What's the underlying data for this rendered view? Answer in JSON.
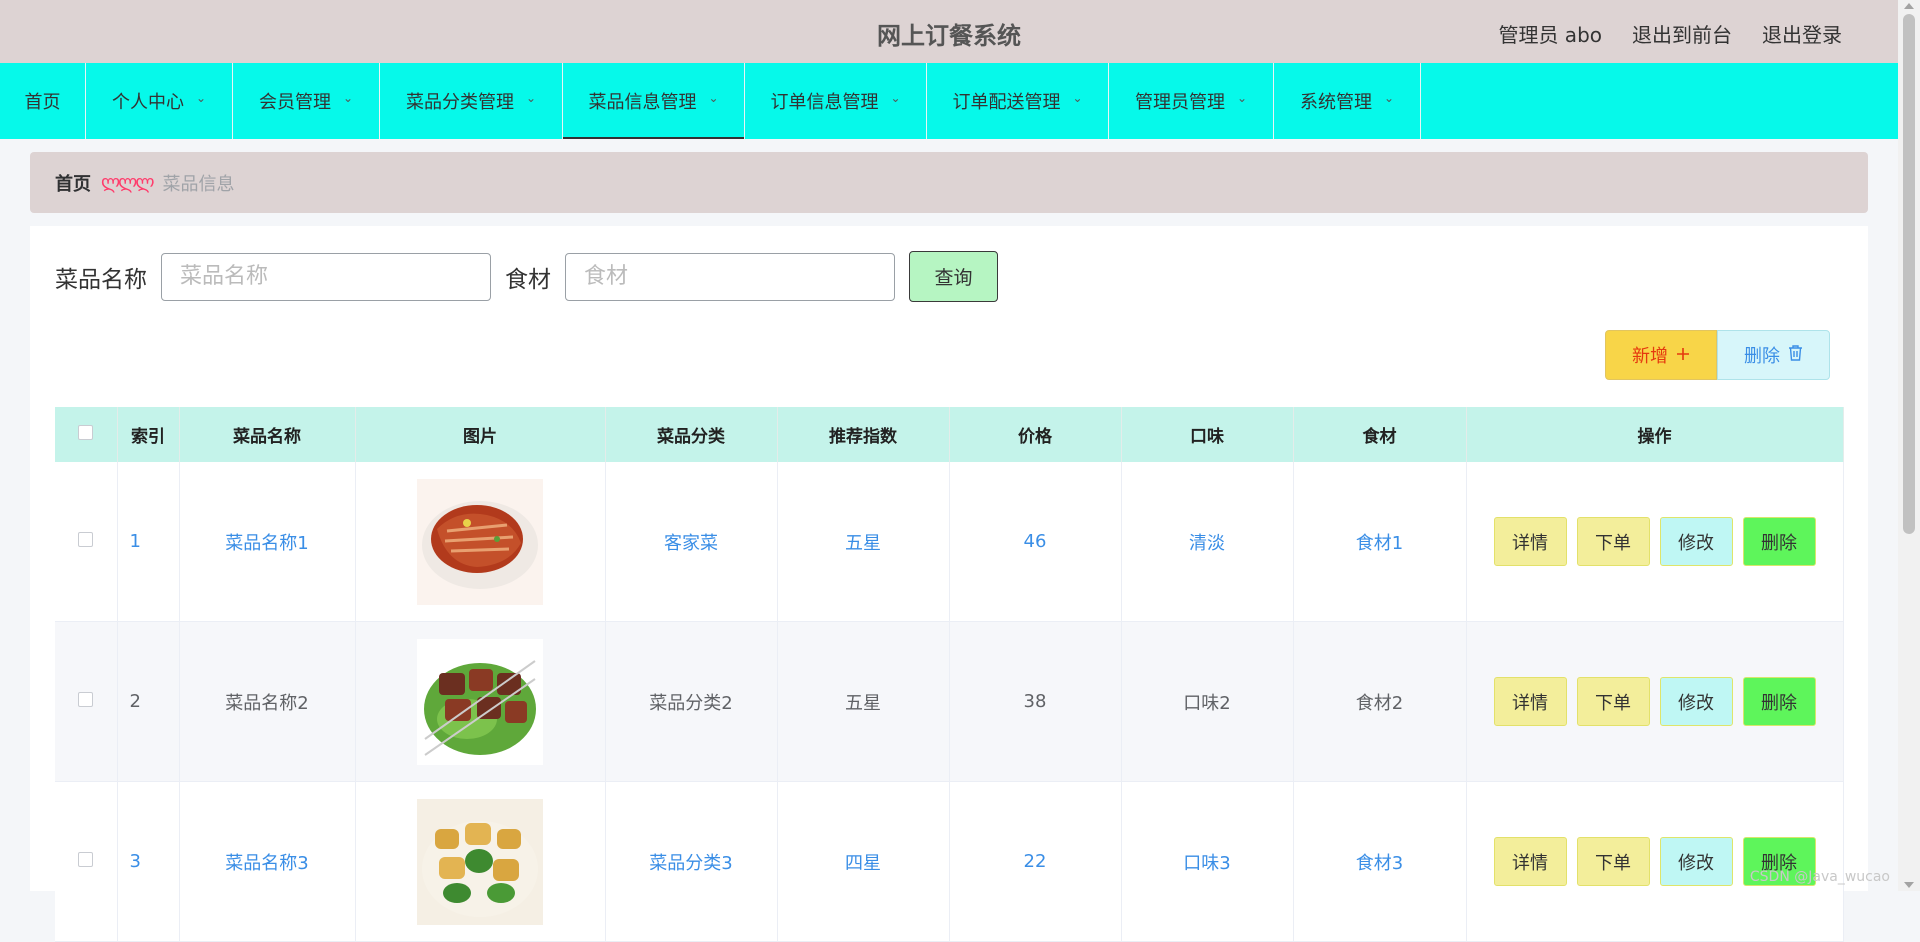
{
  "header": {
    "title": "网上订餐系统",
    "user_label": "管理员 abo",
    "to_front_label": "退出到前台",
    "logout_label": "退出登录"
  },
  "nav": {
    "items": [
      {
        "label": "首页",
        "has_dropdown": false
      },
      {
        "label": "个人中心",
        "has_dropdown": true
      },
      {
        "label": "会员管理",
        "has_dropdown": true
      },
      {
        "label": "菜品分类管理",
        "has_dropdown": true
      },
      {
        "label": "菜品信息管理",
        "has_dropdown": true,
        "active": true
      },
      {
        "label": "订单信息管理",
        "has_dropdown": true
      },
      {
        "label": "订单配送管理",
        "has_dropdown": true
      },
      {
        "label": "管理员管理",
        "has_dropdown": true
      },
      {
        "label": "系统管理",
        "has_dropdown": true
      }
    ]
  },
  "breadcrumb": {
    "home": "首页",
    "separator": "ლლლ",
    "current": "菜品信息"
  },
  "search": {
    "name_label": "菜品名称",
    "name_placeholder": "菜品名称",
    "name_value": "",
    "ingredient_label": "食材",
    "ingredient_placeholder": "食材",
    "ingredient_value": "",
    "query_label": "查询"
  },
  "toolbar": {
    "add_label": "新增",
    "add_icon": "plus-icon",
    "delete_label": "删除",
    "delete_icon": "trash-icon"
  },
  "table": {
    "headers": {
      "index": "索引",
      "name": "菜品名称",
      "image": "图片",
      "category": "菜品分类",
      "rating": "推荐指数",
      "price": "价格",
      "taste": "口味",
      "ingredient": "食材",
      "ops": "操作"
    },
    "rows": [
      {
        "index": "1",
        "name": "菜品名称1",
        "image": "roast-meat",
        "category": "客家菜",
        "rating": "五星",
        "price": "46",
        "taste": "清淡",
        "ingredient": "食材1"
      },
      {
        "index": "2",
        "name": "菜品名称2",
        "image": "kebab-skewers",
        "category": "菜品分类2",
        "rating": "五星",
        "price": "38",
        "taste": "口味2",
        "ingredient": "食材2"
      },
      {
        "index": "3",
        "name": "菜品名称3",
        "image": "tofu-dish",
        "category": "菜品分类3",
        "rating": "四星",
        "price": "22",
        "taste": "口味3",
        "ingredient": "食材3"
      }
    ],
    "row_actions": {
      "detail": "详情",
      "order": "下单",
      "edit": "修改",
      "delete": "删除"
    }
  },
  "watermark": "CSDN @Java_wucao",
  "colors": {
    "header_bg": "#ddd3d3",
    "nav_bg": "#06f9ea",
    "table_header_bg": "#c4f3ea",
    "link_blue": "#3a8ee6"
  }
}
